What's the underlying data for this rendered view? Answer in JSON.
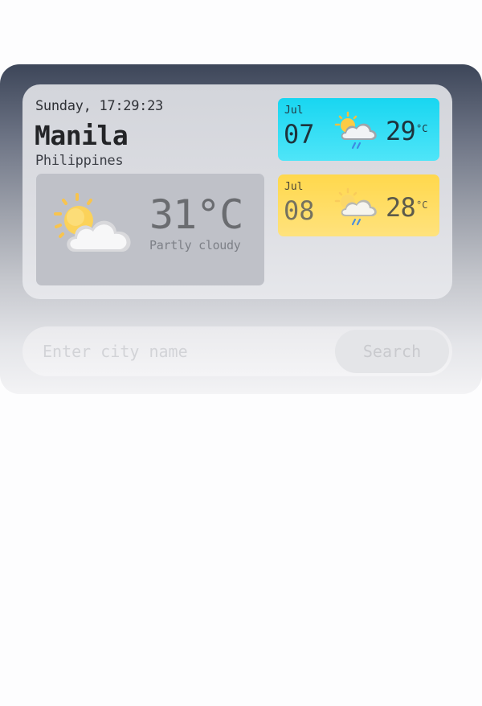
{
  "current": {
    "datetime": "Sunday, 17:29:23",
    "city": "Manila",
    "country": "Philippines",
    "temperature": "31°C",
    "description": "Partly cloudy",
    "icon": "partly-cloudy-icon"
  },
  "forecast": [
    {
      "month": "Jul",
      "date": "07",
      "temperature": "29",
      "unit": "°C",
      "icon": "sun-cloud-rain-icon",
      "color": "#18d6f1"
    },
    {
      "month": "Jul",
      "date": "08",
      "temperature": "28",
      "unit": "°C",
      "icon": "sun-cloud-rain-icon",
      "color": "#ffd84c"
    }
  ],
  "search": {
    "placeholder": "Enter city name",
    "value": "",
    "button_label": "Search"
  }
}
